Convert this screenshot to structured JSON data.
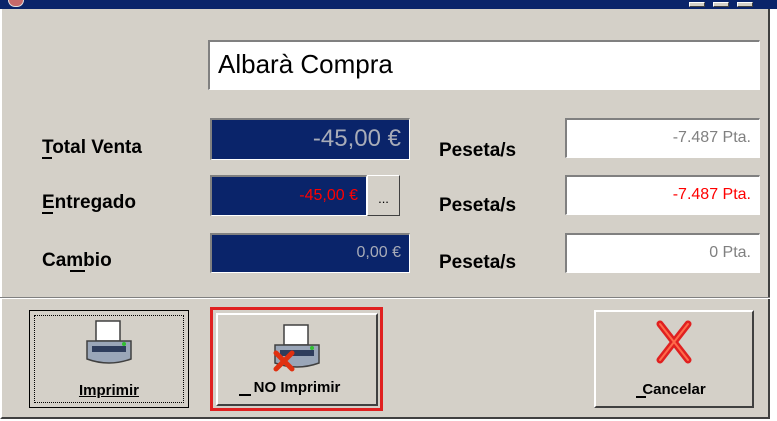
{
  "window": {
    "document_type": "Albarà Compra"
  },
  "totals": {
    "total_venta": {
      "label": "Total Venta",
      "value": "-45,00 €",
      "pesetas_label": "Peseta/s",
      "pesetas_value": "-7.487 Pta."
    },
    "entregado": {
      "label": "Entregado",
      "value": "-45,00 €",
      "ellipsis": "...",
      "pesetas_label": "Peseta/s",
      "pesetas_value": "-7.487 Pta."
    },
    "cambio": {
      "label": "Cambio",
      "value": "0,00 €",
      "pesetas_label": "Peseta/s",
      "pesetas_value": "0 Pta."
    }
  },
  "buttons": {
    "imprimir": "Imprimir",
    "no_imprimir": "NO Imprimir",
    "cancelar": "Cancelar"
  },
  "icons": {
    "printer": "printer-icon",
    "printer_cancel": "printer-cancel-icon",
    "cancel": "red-x-icon"
  },
  "colors": {
    "titlebar": "#0a246a",
    "panel": "#d4d0c8",
    "value_box": "#0a246a",
    "negative_red": "#ff0000",
    "highlight_border": "#e02020"
  }
}
